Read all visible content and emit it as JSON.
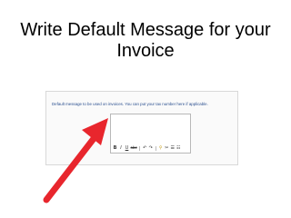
{
  "slide": {
    "title": "Write Default Message for your Invoice"
  },
  "settings": {
    "instructions": "Default message to be used on invoices. You can put your tax number here if applicable.",
    "message_value": ""
  },
  "toolbar": {
    "buttons": [
      {
        "name": "bold-button",
        "glyph": "B",
        "icon": "bold-icon"
      },
      {
        "name": "italic-button",
        "glyph": "I",
        "icon": "italic-icon"
      },
      {
        "name": "underline-button",
        "glyph": "U",
        "icon": "underline-icon"
      },
      {
        "name": "strikethrough-button",
        "glyph": "abc",
        "icon": "strikethrough-icon"
      },
      {
        "name": "undo-button",
        "glyph": "↶",
        "icon": "undo-icon"
      },
      {
        "name": "redo-button",
        "glyph": "↷",
        "icon": "redo-icon"
      },
      {
        "name": "link-button",
        "glyph": "⚲",
        "icon": "link-icon"
      },
      {
        "name": "unlink-button",
        "glyph": "✂",
        "icon": "unlink-icon"
      },
      {
        "name": "bullet-list-button",
        "glyph": "☰",
        "icon": "bullet-list-icon"
      },
      {
        "name": "numbered-list-button",
        "glyph": "☷",
        "icon": "numbered-list-icon"
      }
    ]
  },
  "annotation": {
    "color": "#e8262d",
    "icon": "red-arrow-icon"
  }
}
